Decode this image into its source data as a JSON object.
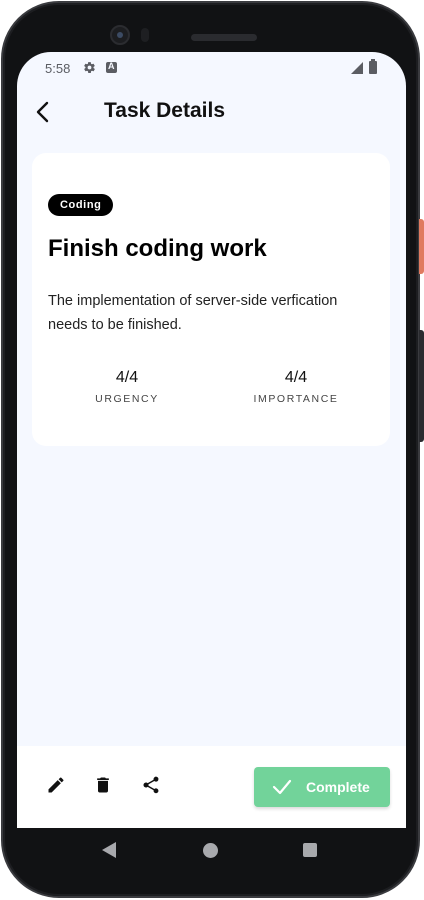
{
  "status_bar": {
    "time": "5:58",
    "icons": [
      "gear-icon",
      "a-badge-icon",
      "signal-icon",
      "battery-icon"
    ]
  },
  "app_bar": {
    "title": "Task Details",
    "back_icon": "chevron-left-icon"
  },
  "task": {
    "tag": "Coding",
    "title": "Finish coding work",
    "description": "The implementation of server-side verfication needs to be finished.",
    "metrics": [
      {
        "value": "4/4",
        "label": "URGENCY"
      },
      {
        "value": "4/4",
        "label": "IMPORTANCE"
      }
    ]
  },
  "bottom_bar": {
    "actions": [
      "pencil-icon",
      "trash-icon",
      "share-icon"
    ],
    "complete_label": "Complete",
    "complete_color": "#72d39a"
  },
  "nav_bar": {
    "icons": [
      "nav-back-icon",
      "nav-home-icon",
      "nav-recent-icon"
    ]
  },
  "colors": {
    "screen_background": "#f5f8ff",
    "card_background": "#ffffff",
    "tag_background": "#000000",
    "accent": "#72d39a"
  }
}
